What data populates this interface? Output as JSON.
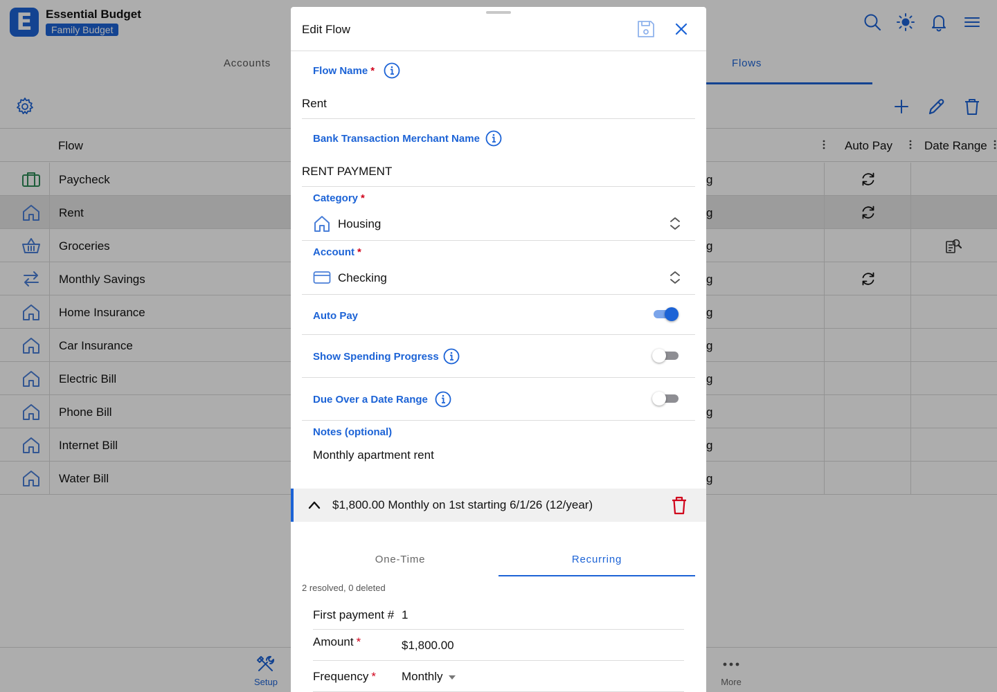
{
  "app": {
    "logo_letter": "E",
    "title": "Essential Budget",
    "budget_name": "Family Budget"
  },
  "top_icons": [
    "search-icon",
    "brightness-icon",
    "notifications-icon",
    "menu-icon"
  ],
  "tabs": [
    {
      "label": "Accounts",
      "active": false
    },
    {
      "label": "Flows",
      "active": true
    }
  ],
  "table": {
    "columns": [
      "Flow",
      "Auto Pay",
      "Date Range"
    ],
    "rows": [
      {
        "name": "Paycheck",
        "icon": "briefcase-icon",
        "auto_pay": true,
        "date_range": false,
        "selected": false
      },
      {
        "name": "Rent",
        "icon": "house-icon",
        "auto_pay": true,
        "date_range": false,
        "selected": true
      },
      {
        "name": "Groceries",
        "icon": "basket-icon",
        "auto_pay": false,
        "date_range": true,
        "selected": false
      },
      {
        "name": "Monthly Savings",
        "icon": "transfer-icon",
        "auto_pay": true,
        "date_range": false,
        "selected": false
      },
      {
        "name": "Home Insurance",
        "icon": "house-icon",
        "auto_pay": false,
        "date_range": false,
        "selected": false
      },
      {
        "name": "Car Insurance",
        "icon": "house-icon",
        "auto_pay": false,
        "date_range": false,
        "selected": false
      },
      {
        "name": "Electric Bill",
        "icon": "house-icon",
        "auto_pay": false,
        "date_range": false,
        "selected": false
      },
      {
        "name": "Phone Bill",
        "icon": "house-icon",
        "auto_pay": false,
        "date_range": false,
        "selected": false
      },
      {
        "name": "Internet Bill",
        "icon": "house-icon",
        "auto_pay": false,
        "date_range": false,
        "selected": false
      },
      {
        "name": "Water Bill",
        "icon": "house-icon",
        "auto_pay": false,
        "date_range": false,
        "selected": false
      }
    ],
    "truncated_glyph": "g"
  },
  "bottom_nav": {
    "setup_label": "Setup",
    "more_label": "More"
  },
  "colors": {
    "accent": "#1c63d6",
    "danger": "#d0021b",
    "green": "#2e8b57"
  },
  "modal": {
    "title": "Edit Flow",
    "required_mark": "*",
    "flow_name": {
      "label": "Flow Name",
      "value": "Rent"
    },
    "merchant": {
      "label": "Bank Transaction Merchant Name",
      "value": "RENT PAYMENT"
    },
    "category": {
      "label": "Category",
      "value": "Housing"
    },
    "account": {
      "label": "Account",
      "value": "Checking"
    },
    "auto_pay": {
      "label": "Auto Pay",
      "on": true
    },
    "spending_progress": {
      "label": "Show Spending Progress",
      "on": false
    },
    "date_range": {
      "label": "Due Over a Date Range",
      "on": false
    },
    "notes": {
      "label": "Notes (optional)",
      "value": "Monthly apartment rent"
    },
    "schedule": {
      "summary": "$1,800.00 Monthly on 1st starting 6/1/26 (12/year)",
      "tabs": [
        {
          "label": "One-Time",
          "active": false
        },
        {
          "label": "Recurring",
          "active": true
        }
      ],
      "resolved_text": "2 resolved, 0 deleted",
      "first_payment": {
        "label": "First payment #",
        "value": "1"
      },
      "amount": {
        "label": "Amount",
        "value": "$1,800.00"
      },
      "frequency": {
        "label": "Frequency",
        "value": "Monthly"
      }
    }
  }
}
